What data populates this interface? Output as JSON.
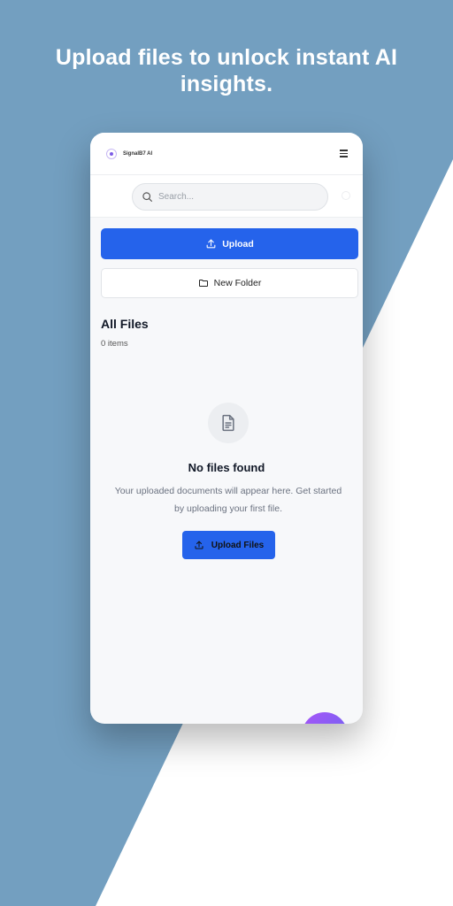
{
  "promo": {
    "headline": "Upload files to unlock instant AI insights."
  },
  "app": {
    "brand": "SignalB7 AI",
    "search": {
      "placeholder": "Search..."
    },
    "actions": {
      "upload_label": "Upload",
      "new_folder_label": "New Folder"
    },
    "section": {
      "title": "All Files",
      "count": "0 items"
    },
    "empty_state": {
      "title": "No files found",
      "description": "Your uploaded documents will appear here. Get started by uploading your first file.",
      "button_label": "Upload Files"
    }
  },
  "colors": {
    "background": "#739fc0",
    "primary": "#2563eb",
    "fab_gradient_start": "#a855f7",
    "fab_gradient_end": "#6366f1"
  },
  "icons": {
    "logo": "logo-icon",
    "menu": "hamburger-menu-icon",
    "search": "search-icon",
    "upload": "upload-icon",
    "folder": "folder-icon",
    "document": "document-icon",
    "fab": "ai-assistant-icon"
  }
}
